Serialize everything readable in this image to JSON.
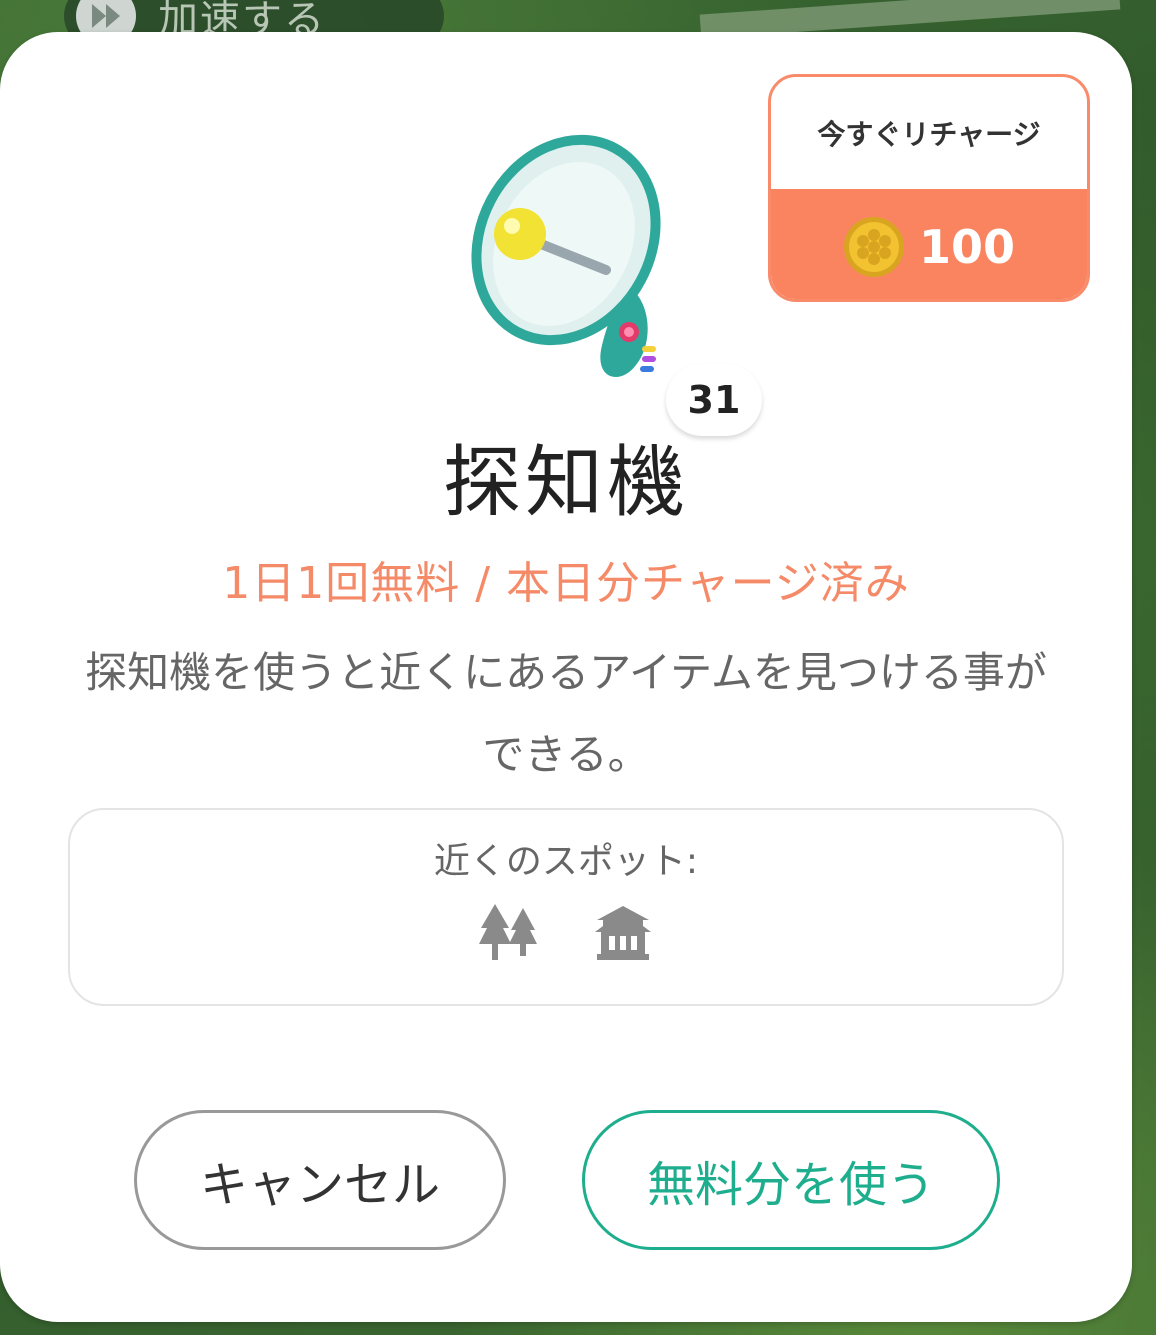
{
  "background": {
    "speed_label": "加速する"
  },
  "dialog": {
    "item_name": "探知機",
    "item_count": "31",
    "status_text": "1日1回無料 / 本日分チャージ済み",
    "description": "探知機を使うと近くにあるアイテムを見つける事ができる。",
    "recharge": {
      "label": "今すぐリチャージ",
      "price": "100"
    },
    "nearby": {
      "label": "近くのスポット:",
      "icons": [
        "forest-icon",
        "shrine-icon"
      ]
    },
    "buttons": {
      "cancel": "キャンセル",
      "use_free": "無料分を使う"
    }
  },
  "colors": {
    "accent_orange": "#f9845f",
    "status_text": "#f58a68",
    "primary_green": "#1fae8d",
    "gold_coin": "#f2c230"
  }
}
